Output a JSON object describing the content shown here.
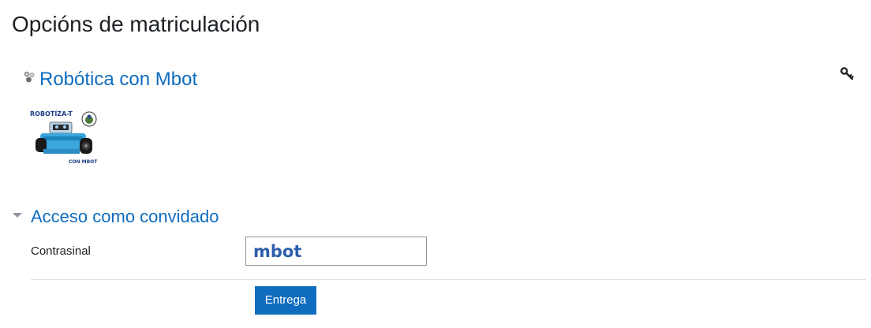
{
  "page": {
    "title": "Opcións de matriculación"
  },
  "course": {
    "name": "Robótica con Mbot",
    "icon": "course-icon",
    "image_text_top": "ROBOTÍZA-T",
    "image_text_bottom": "CON MBOT"
  },
  "enrolment": {
    "section_title": "Acceso como convidado",
    "password_label": "Contrasinal",
    "password_value": "mbot",
    "submit_label": "Entrega",
    "key_icon": "key-icon",
    "collapse_icon": "chevron-down-icon"
  },
  "colors": {
    "link": "#0f6cbf",
    "button": "#0f6cbf",
    "text": "#1d2125",
    "divider": "#dee2e6"
  }
}
